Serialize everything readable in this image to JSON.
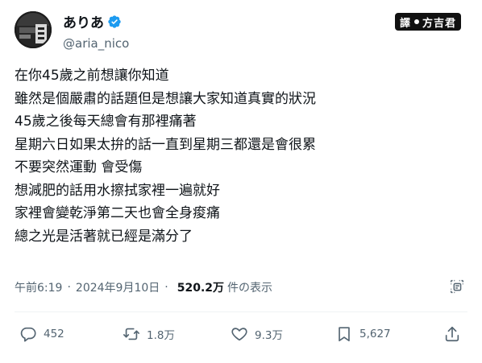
{
  "author": {
    "display_name": "ありあ",
    "handle": "@aria_nico"
  },
  "watermark": {
    "left": "譯",
    "right": "方吉君"
  },
  "tweet": {
    "lines": [
      "在你45歲之前想讓你知道",
      "雖然是個嚴肅的話題但是想讓大家知道真實的狀況",
      "45歲之後每天總會有那裡痛著",
      "星期六日如果太拚的話一直到星期三都還是會很累",
      "不要突然運動 會受傷",
      "想減肥的話用水擦拭家裡一遍就好",
      "家裡會變乾淨第二天也會全身痠痛",
      "總之光是活著就已經是滿分了"
    ]
  },
  "meta": {
    "time": "午前6:19",
    "date": "2024年9月10日",
    "views_count": "520.2万",
    "views_label": "件の表示"
  },
  "actions": {
    "replies": "452",
    "reposts": "1.8万",
    "likes": "9.3万",
    "bookmarks": "5,627"
  },
  "colors": {
    "verified": "#1d9bf0",
    "text": "#0f1419",
    "muted": "#536471"
  }
}
